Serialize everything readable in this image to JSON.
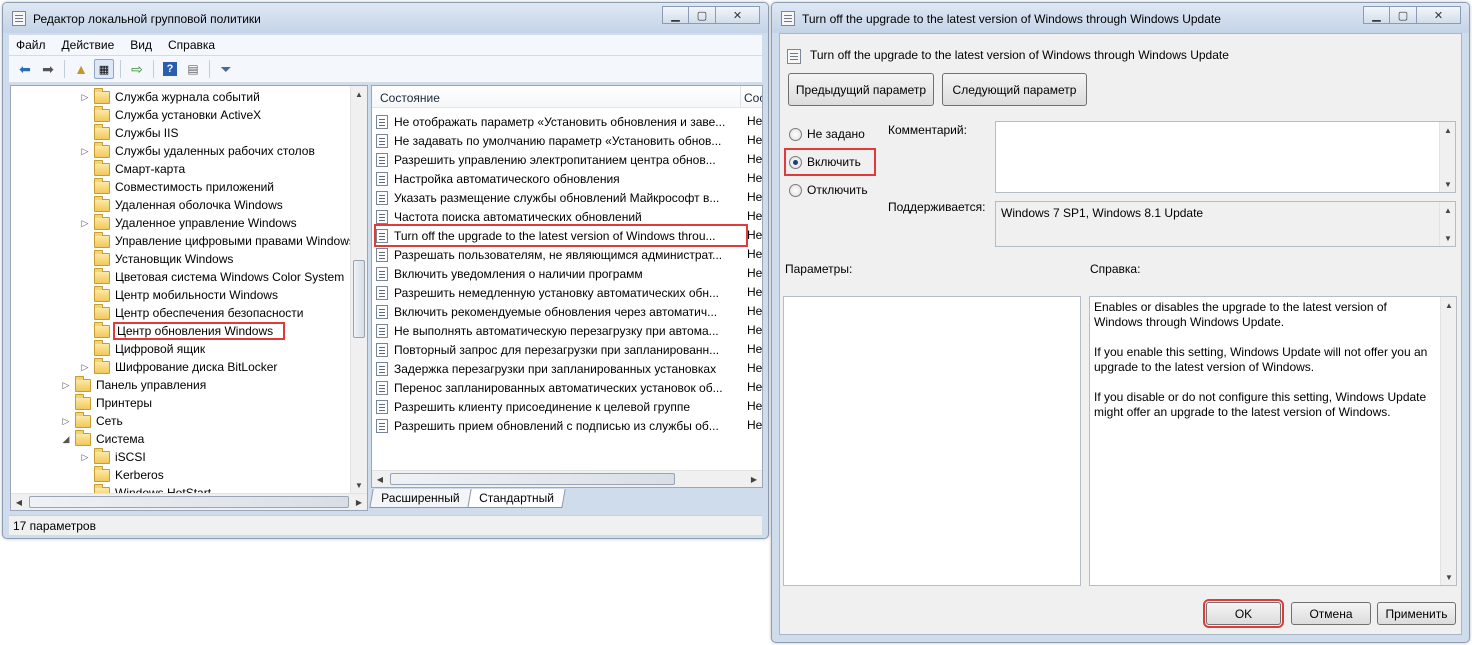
{
  "editor": {
    "title": "Редактор локальной групповой политики",
    "menu": [
      "Файл",
      "Действие",
      "Вид",
      "Справка"
    ],
    "tree": [
      {
        "label": "Служба журнала событий",
        "expandable": true
      },
      {
        "label": "Служба установки ActiveX",
        "expandable": false
      },
      {
        "label": "Службы IIS",
        "expandable": false
      },
      {
        "label": "Службы удаленных рабочих столов",
        "expandable": true
      },
      {
        "label": "Смарт-карта",
        "expandable": false
      },
      {
        "label": "Совместимость приложений",
        "expandable": false
      },
      {
        "label": "Удаленная оболочка Windows",
        "expandable": false
      },
      {
        "label": "Удаленное управление Windows",
        "expandable": true
      },
      {
        "label": "Управление цифровыми правами Windows",
        "expandable": false
      },
      {
        "label": "Установщик Windows",
        "expandable": false
      },
      {
        "label": "Цветовая система Windows Color System",
        "expandable": false
      },
      {
        "label": "Центр мобильности Windows",
        "expandable": false
      },
      {
        "label": "Центр обеспечения безопасности",
        "expandable": false
      },
      {
        "label": "Центр обновления Windows",
        "expandable": false,
        "selected": true
      },
      {
        "label": "Цифровой ящик",
        "expandable": false
      },
      {
        "label": "Шифрование диска BitLocker",
        "expandable": true
      },
      {
        "label": "Панель управления",
        "expandable": true,
        "level": 0
      },
      {
        "label": "Принтеры",
        "expandable": false,
        "level": 0
      },
      {
        "label": "Сеть",
        "expandable": true,
        "level": 0
      },
      {
        "label": "Система",
        "expandable": true,
        "expanded": true,
        "level": 0
      },
      {
        "label": "iSCSI",
        "expandable": true
      },
      {
        "label": "Kerberos",
        "expandable": false
      },
      {
        "label": "Windows HotStart",
        "expandable": false
      }
    ],
    "list_header": {
      "col1": "Состояние",
      "col2": "Сос"
    },
    "policies": [
      {
        "name": "Не отображать параметр «Установить обновления и заве...",
        "state": "Не"
      },
      {
        "name": "Не задавать по умолчанию параметр «Установить обнов...",
        "state": "Не"
      },
      {
        "name": "Разрешить управлению электропитанием центра обнов...",
        "state": "Не"
      },
      {
        "name": "Настройка автоматического обновления",
        "state": "Не"
      },
      {
        "name": "Указать размещение службы обновлений Майкрософт в...",
        "state": "Не"
      },
      {
        "name": "Частота поиска автоматических обновлений",
        "state": "Не"
      },
      {
        "name": "Turn off the upgrade to the latest version of Windows throu...",
        "state": "Не",
        "selected": true
      },
      {
        "name": "Разрешать пользователям, не являющимся администрат...",
        "state": "Не"
      },
      {
        "name": "Включить уведомления о наличии программ",
        "state": "Не"
      },
      {
        "name": "Разрешить немедленную установку автоматических обн...",
        "state": "Не"
      },
      {
        "name": "Включить рекомендуемые обновления через автоматич...",
        "state": "Не"
      },
      {
        "name": "Не выполнять автоматическую перезагрузку при автома...",
        "state": "Не"
      },
      {
        "name": "Повторный запрос для перезагрузки при запланированн...",
        "state": "Не"
      },
      {
        "name": "Задержка перезагрузки при запланированных установках",
        "state": "Не"
      },
      {
        "name": "Перенос запланированных автоматических установок об...",
        "state": "Не"
      },
      {
        "name": "Разрешить клиенту присоединение к целевой группе",
        "state": "Не"
      },
      {
        "name": "Разрешить прием обновлений с подписью из службы об...",
        "state": "Не"
      }
    ],
    "tabs": [
      "Расширенный",
      "Стандартный"
    ],
    "status": "17 параметров"
  },
  "dialog": {
    "title": "Turn off the upgrade to the latest version of Windows through Windows Update",
    "setting_name": "Turn off the upgrade to the latest version of Windows through Windows Update",
    "prev_button": "Предыдущий параметр",
    "next_button": "Следующий параметр",
    "radio": {
      "not_configured": "Не задано",
      "enabled": "Включить",
      "disabled": "Отключить",
      "selected": "enabled"
    },
    "comment_label": "Комментарий:",
    "supported_label": "Поддерживается:",
    "supported_value": "Windows 7 SP1, Windows 8.1 Update",
    "options_label": "Параметры:",
    "help_label": "Справка:",
    "help_text": [
      "Enables or disables the upgrade to the latest version of Windows through Windows Update.",
      "If you enable this setting, Windows Update will not offer you an upgrade to the latest version of Windows.",
      "If you disable or do not configure this setting, Windows Update might offer an upgrade to the latest version of Windows."
    ],
    "ok_button": "OK",
    "cancel_button": "Отмена",
    "apply_button": "Применить"
  },
  "colors": {
    "highlight": "#e03a3a",
    "frame": "#cfdcec"
  }
}
